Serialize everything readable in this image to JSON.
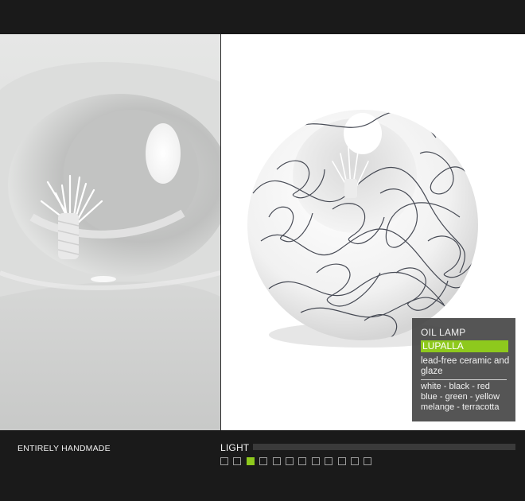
{
  "product": {
    "kicker": "OIL LAMP",
    "name": "LUPALLA",
    "material": "lead-free ceramic and glaze",
    "colors": [
      "white - black - red",
      "blue - green - yellow",
      "melange - terracotta"
    ]
  },
  "footer": {
    "tagline": "ENTIRELY HANDMADE",
    "category": "LIGHT",
    "progress": 0
  },
  "pager": {
    "count": 12,
    "active_index": 2
  },
  "colors": {
    "accent": "#8ec91d",
    "background": "#1a1a1a",
    "panel": "#464646"
  }
}
